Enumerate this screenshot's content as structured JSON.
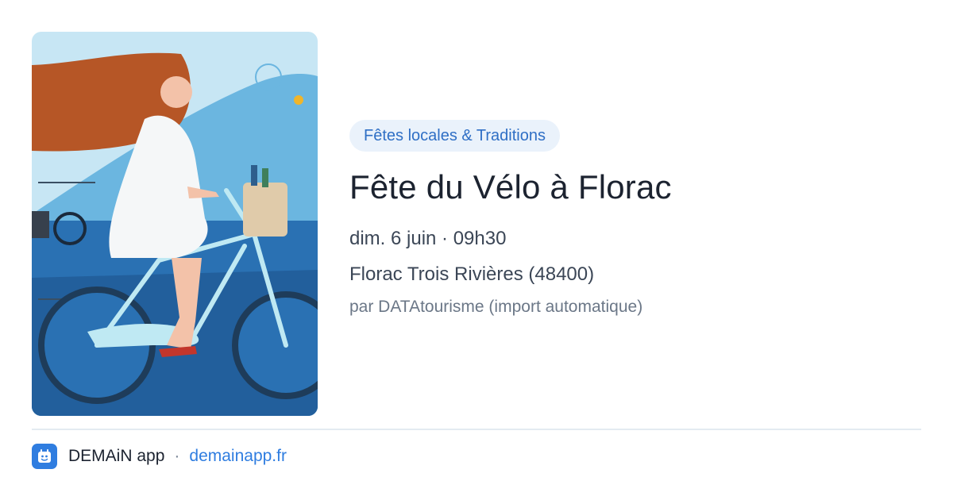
{
  "event": {
    "image_alt": "Illustration d'une femme à vélo",
    "category": "Fêtes locales & Traditions",
    "title": "Fête du Vélo à Florac",
    "date": "dim. 6 juin · 09h30",
    "place": "Florac Trois Rivières (48400)",
    "source": "par DATAtourisme (import automatique)"
  },
  "footer": {
    "app_name": "DEMAiN app",
    "separator": "·",
    "link": "demainapp.fr"
  },
  "colors": {
    "accent": "#2f7de0",
    "chip_bg": "#eaf2fb",
    "chip_text": "#2f6fc5",
    "title": "#1c2330"
  },
  "icons": {
    "app": "demain-app-logo-icon"
  }
}
